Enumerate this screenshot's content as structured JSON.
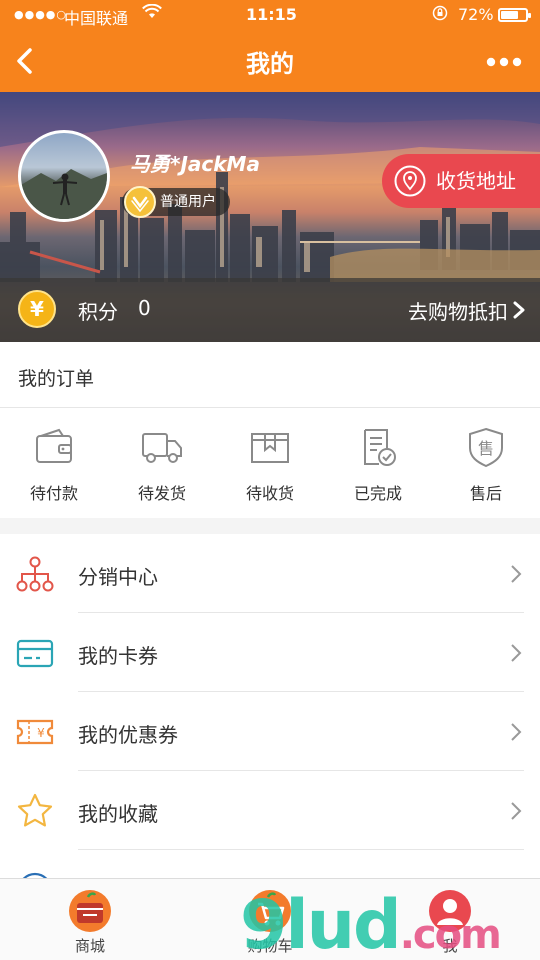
{
  "status_bar": {
    "signal_dots": "●●●●○",
    "carrier": "中国联通",
    "time": "11:15",
    "battery_text": "72%",
    "battery_level": 0.72
  },
  "nav": {
    "title": "我的"
  },
  "profile": {
    "username": "马勇*JackMa",
    "level": "普通用户",
    "address_button": "收货地址",
    "points_label": "积分",
    "points_value": "0",
    "points_coin": "¥",
    "deduct_link": "去购物抵扣"
  },
  "orders": {
    "title": "我的订单",
    "items": [
      {
        "label": "待付款",
        "icon": "wallet-icon"
      },
      {
        "label": "待发货",
        "icon": "truck-icon"
      },
      {
        "label": "待收货",
        "icon": "package-icon"
      },
      {
        "label": "已完成",
        "icon": "document-check-icon"
      },
      {
        "label": "售后",
        "icon": "after-sales-shield-icon"
      }
    ]
  },
  "menu": {
    "items": [
      {
        "label": "分销中心",
        "icon": "network-icon"
      },
      {
        "label": "我的卡券",
        "icon": "card-icon"
      },
      {
        "label": "我的优惠券",
        "icon": "coupon-icon"
      },
      {
        "label": "我的收藏",
        "icon": "star-icon"
      }
    ]
  },
  "tabbar": {
    "items": [
      {
        "label": "商城",
        "icon": "shop-icon"
      },
      {
        "label": "购物车",
        "icon": "cart-icon"
      },
      {
        "label": "我",
        "icon": "user-icon"
      }
    ]
  },
  "watermark": {
    "text_main": "9lud",
    "text_dot": ".com"
  },
  "colors": {
    "brand_orange": "#f7831c",
    "address_red": "#e9484f",
    "coin_gold": "#f5b417",
    "icon_red": "#e2564a",
    "icon_teal": "#2aa5b5",
    "icon_orange": "#f08a3a",
    "icon_yellow": "#f3b640"
  }
}
